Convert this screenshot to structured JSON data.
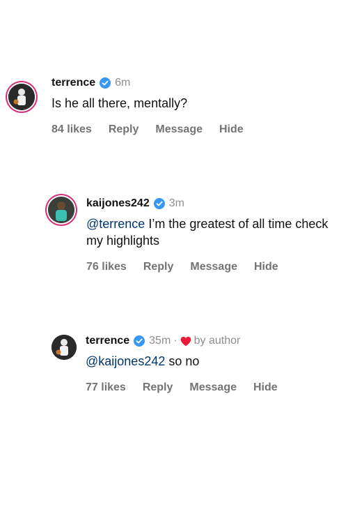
{
  "comments": [
    {
      "username": "terrence",
      "time": "6m",
      "text": "Is he all there, mentally?",
      "likes": "84 likes",
      "reply": "Reply",
      "message": "Message",
      "hide": "Hide",
      "avatar_icon": "avatar-terrence"
    },
    {
      "username": "kaijones242",
      "time": "3m",
      "mention": "@terrence",
      "text": " I’m the greatest of all time check my highlights",
      "likes": "76 likes",
      "reply": "Reply",
      "message": "Message",
      "hide": "Hide",
      "avatar_icon": "avatar-kaijones"
    },
    {
      "username": "terrence",
      "time": "35m",
      "separator": "·",
      "liked_by_author": "by author",
      "mention": "@kaijones242",
      "text": " so no",
      "likes": "77 likes",
      "reply": "Reply",
      "message": "Message",
      "hide": "Hide",
      "avatar_icon": "avatar-terrence"
    }
  ],
  "colors": {
    "verified": "#3897f0",
    "heart": "#ed1a3a",
    "mention": "#00376b",
    "muted": "#8e8e8e",
    "story_ring": "#d6307a"
  }
}
